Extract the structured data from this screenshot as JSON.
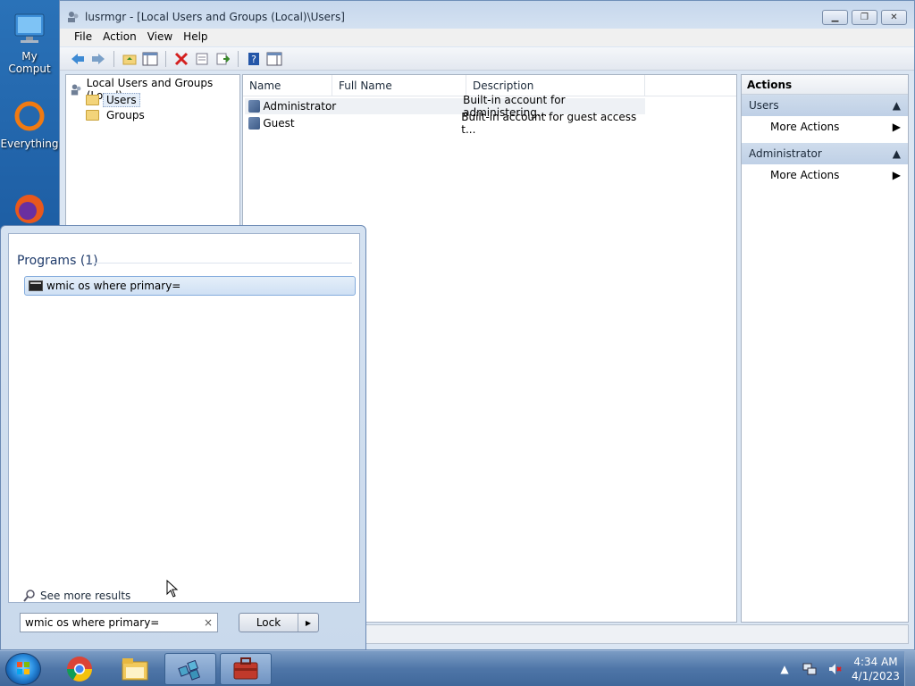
{
  "desktop": {
    "icons": [
      {
        "label": "My Comput",
        "icon": "monitor-icon"
      },
      {
        "label": "Everything",
        "icon": "everything-search-icon"
      },
      {
        "label": "",
        "icon": "firefox-icon"
      }
    ]
  },
  "window": {
    "title": "lusrmgr - [Local Users and Groups (Local)\\Users]",
    "menu": [
      "File",
      "Action",
      "View",
      "Help"
    ],
    "tree": {
      "root": "Local Users and Groups (Local)",
      "children": [
        "Users",
        "Groups"
      ],
      "selected": "Users"
    },
    "list": {
      "columns": [
        "Name",
        "Full Name",
        "Description"
      ],
      "rows": [
        {
          "name": "Administrator",
          "full_name": "",
          "description": "Built-in account for administering..."
        },
        {
          "name": "Guest",
          "full_name": "",
          "description": "Built-in account for guest access t..."
        }
      ]
    },
    "actions": {
      "header": "Actions",
      "sections": [
        {
          "title": "Users",
          "item": "More Actions"
        },
        {
          "title": "Administrator",
          "item": "More Actions"
        }
      ]
    }
  },
  "start_menu": {
    "section_title": "Programs (1)",
    "results": [
      "wmic os where primary="
    ],
    "see_more": "See more results",
    "search_value": "wmic os where primary=",
    "clear_glyph": "×",
    "power_button": "Lock"
  },
  "taskbar": {
    "apps": [
      "windows-explorer-icon",
      "chrome-icon",
      "file-explorer-icon",
      "registry-editor-icon",
      "computer-management-icon"
    ],
    "clock": {
      "time": "4:34 AM",
      "date": "4/1/2023"
    }
  }
}
